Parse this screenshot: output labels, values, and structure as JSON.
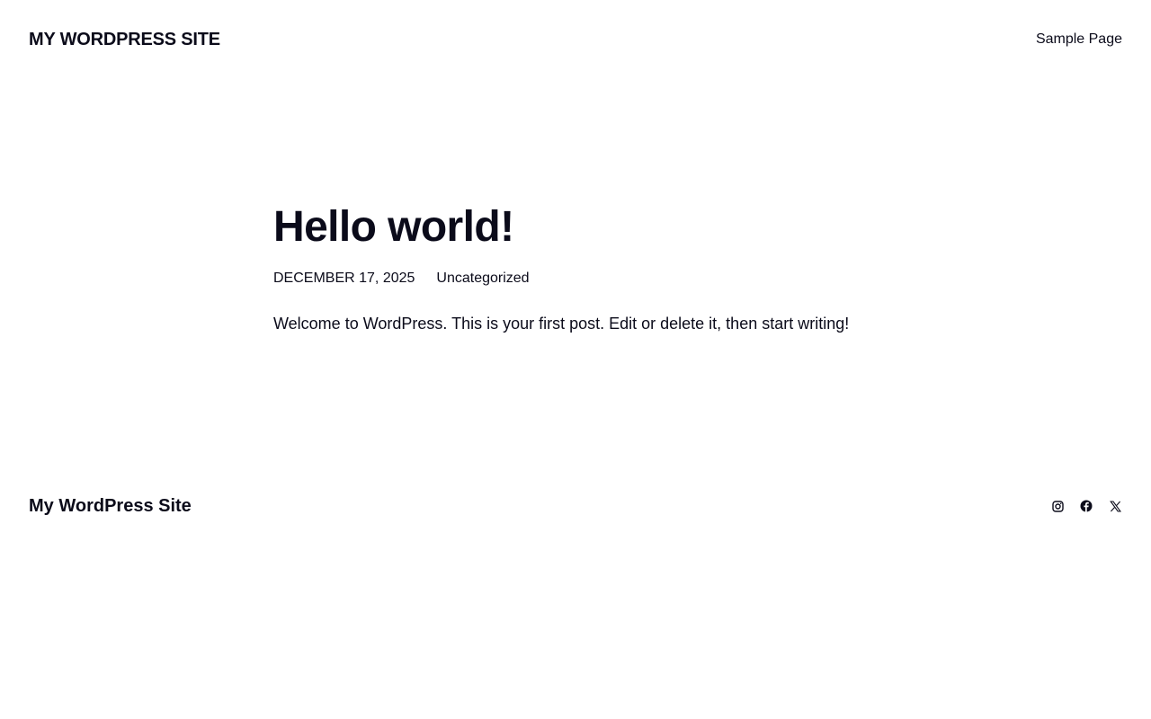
{
  "header": {
    "site_title": "MY WORDPRESS SITE",
    "nav": [
      {
        "label": "Sample Page"
      }
    ]
  },
  "post": {
    "title": "Hello world!",
    "date": "DECEMBER 17, 2025",
    "category": "Uncategorized",
    "excerpt": "Welcome to WordPress. This is your first post. Edit or delete it, then start writing!"
  },
  "footer": {
    "site_title": "My WordPress Site",
    "social": [
      {
        "icon": "instagram-icon"
      },
      {
        "icon": "facebook-icon"
      },
      {
        "icon": "x-icon"
      }
    ]
  },
  "colors": {
    "text": "#0b0b1a",
    "background": "#ffffff"
  }
}
